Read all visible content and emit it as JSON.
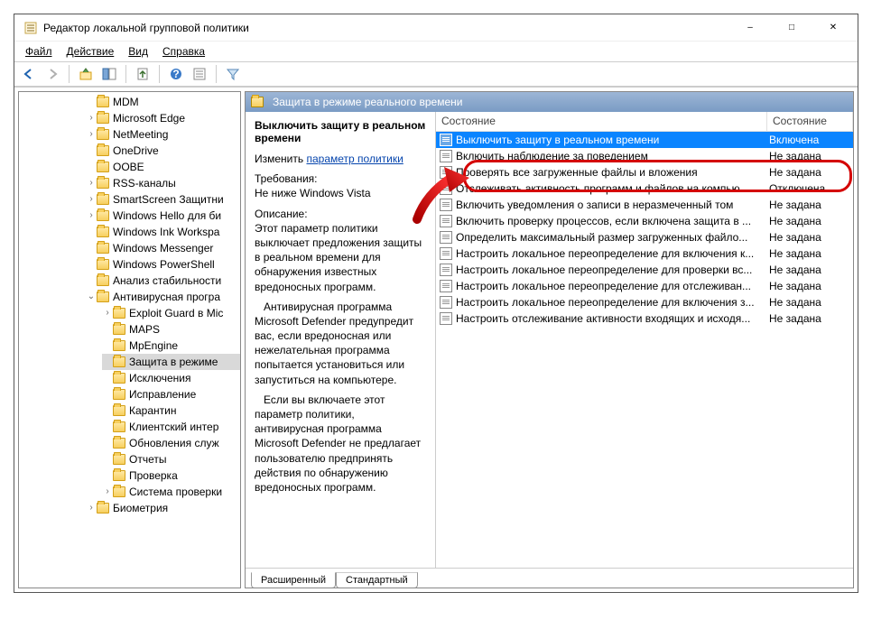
{
  "window": {
    "title": "Редактор локальной групповой политики"
  },
  "menu": {
    "file": "Файл",
    "action": "Действие",
    "view": "Вид",
    "help": "Справка"
  },
  "tree": [
    {
      "label": "MDM",
      "exp": ""
    },
    {
      "label": "Microsoft Edge",
      "exp": "›"
    },
    {
      "label": "NetMeeting",
      "exp": "›"
    },
    {
      "label": "OneDrive",
      "exp": ""
    },
    {
      "label": "OOBE",
      "exp": ""
    },
    {
      "label": "RSS-каналы",
      "exp": "›"
    },
    {
      "label": "SmartScreen Защитни",
      "exp": "›"
    },
    {
      "label": "Windows Hello для би",
      "exp": "›"
    },
    {
      "label": "Windows Ink Workspa",
      "exp": ""
    },
    {
      "label": "Windows Messenger",
      "exp": ""
    },
    {
      "label": "Windows PowerShell",
      "exp": ""
    },
    {
      "label": "Анализ стабильности",
      "exp": ""
    },
    {
      "label": "Антивирусная програ",
      "exp": "⌄",
      "children": [
        {
          "label": "Exploit Guard в Mic",
          "exp": "›"
        },
        {
          "label": "MAPS",
          "exp": ""
        },
        {
          "label": "MpEngine",
          "exp": ""
        },
        {
          "label": "Защита в режиме",
          "exp": "",
          "selected": true
        },
        {
          "label": "Исключения",
          "exp": ""
        },
        {
          "label": "Исправление",
          "exp": ""
        },
        {
          "label": "Карантин",
          "exp": ""
        },
        {
          "label": "Клиентский интер",
          "exp": ""
        },
        {
          "label": "Обновления служ",
          "exp": ""
        },
        {
          "label": "Отчеты",
          "exp": ""
        },
        {
          "label": "Проверка",
          "exp": ""
        },
        {
          "label": "Система проверки",
          "exp": "›"
        }
      ]
    },
    {
      "label": "Биометрия",
      "exp": "›"
    }
  ],
  "header_path": "Защита в режиме реального времени",
  "desc": {
    "title": "Выключить защиту в реальном времени",
    "edit_label": "Изменить",
    "edit_link": "параметр политики",
    "req_h": "Требования:",
    "req_v": "Не ниже Windows Vista",
    "desc_h": "Описание:",
    "p1": "Этот параметр политики выключает предложения защиты в реальном времени для обнаружения известных вредоносных программ.",
    "p2": "Антивирусная программа Microsoft Defender предупредит вас, если вредоносная или нежелательная программа попытается установиться или запуститься на компьютере.",
    "p3": "Если вы включаете этот параметр политики, антивирусная программа Microsoft Defender не предлагает пользователю предпринять действия по обнаружению вредоносных программ."
  },
  "list": {
    "col1": "Состояние",
    "col2": "Состояние",
    "rows": [
      {
        "name": "Выключить защиту в реальном времени",
        "state": "Включена",
        "selected": true
      },
      {
        "name": "Включить наблюдение за поведением",
        "state": "Не задана"
      },
      {
        "name": "Проверять все загруженные файлы и вложения",
        "state": "Не задана"
      },
      {
        "name": "Отслеживать активность программ и файлов на компью...",
        "state": "Отключена"
      },
      {
        "name": "Включить уведомления о записи в неразмеченный том",
        "state": "Не задана"
      },
      {
        "name": "Включить проверку процессов, если включена защита в ...",
        "state": "Не задана"
      },
      {
        "name": "Определить максимальный размер загруженных файло...",
        "state": "Не задана"
      },
      {
        "name": "Настроить локальное переопределение для включения к...",
        "state": "Не задана"
      },
      {
        "name": "Настроить локальное переопределение для проверки вс...",
        "state": "Не задана"
      },
      {
        "name": "Настроить локальное переопределение для отслеживан...",
        "state": "Не задана"
      },
      {
        "name": "Настроить локальное переопределение для включения з...",
        "state": "Не задана"
      },
      {
        "name": "Настроить отслеживание активности входящих и исходя...",
        "state": "Не задана"
      }
    ]
  },
  "tabs": {
    "extended": "Расширенный",
    "standard": "Стандартный"
  }
}
